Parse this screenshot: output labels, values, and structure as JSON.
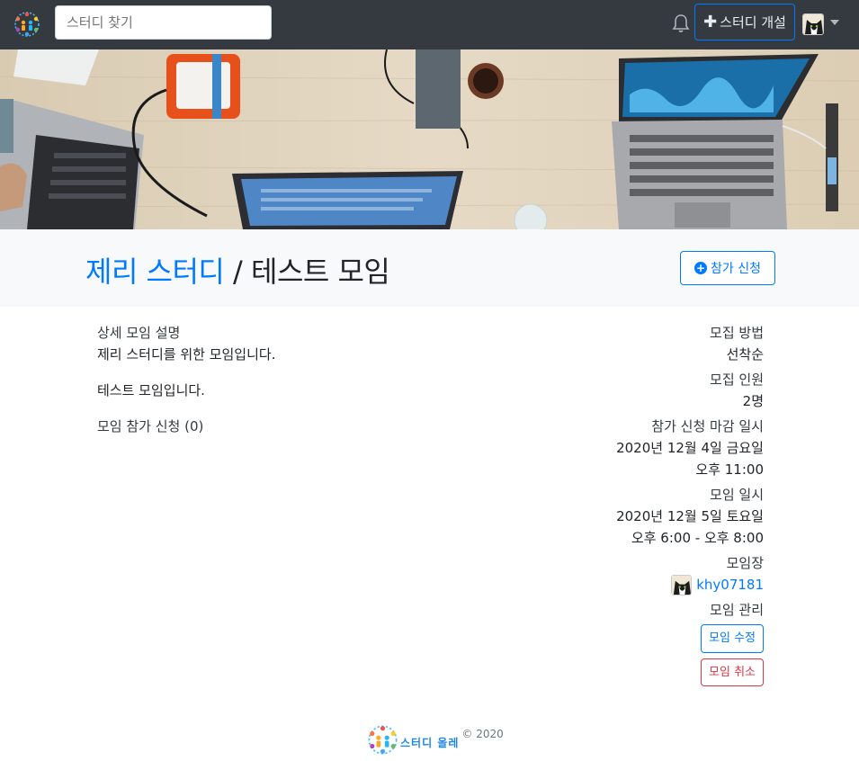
{
  "navbar": {
    "search_placeholder": "스터디 찾기",
    "open_study_label": "스터디 개설"
  },
  "header": {
    "study_name": "제리 스터디",
    "separator": " / ",
    "event_title": "테스트 모임",
    "join_label": "참가 신청"
  },
  "details": {
    "section_label": "상세 모임 설명",
    "short_description": "제리 스터디를 위한 모임입니다.",
    "full_description": "테스트 모임입니다.",
    "attendees_label": "모임 참가 신청 (0)"
  },
  "info": {
    "recruit_method_label": "모집 방법",
    "recruit_method_value": "선착순",
    "limit_label": "모집 인원",
    "limit_value": "2명",
    "deadline_label": "참가 신청 마감 일시",
    "deadline_date": "2020년 12월 4일 금요일",
    "deadline_time": "오후 11:00",
    "schedule_label": "모임 일시",
    "schedule_date": "2020년 12월 5일 토요일",
    "schedule_time": "오후 6:00 - 오후 8:00",
    "manager_label": "모임장",
    "manager_name": "khy07181",
    "manage_label": "모임 관리",
    "edit_label": "모임 수정",
    "cancel_label": "모임 취소"
  },
  "footer": {
    "brand": "스터디 올레",
    "copyright": "© 2020"
  },
  "colors": {
    "primary": "#007bff",
    "danger": "#dc3545",
    "navbar": "#343a40",
    "title_bg": "#f8f9fa"
  },
  "icons": [
    "logo-icon",
    "bell-icon",
    "plus-icon",
    "plus-circle-icon",
    "avatar",
    "caret-down-icon"
  ]
}
